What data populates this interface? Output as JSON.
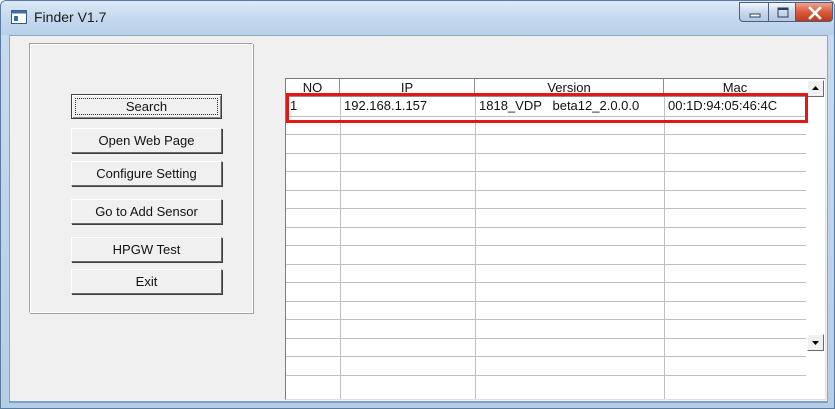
{
  "window": {
    "title": "Finder V1.7",
    "icons": {
      "app": "window-app-icon",
      "minimize": "minimize-icon",
      "maximize": "maximize-icon",
      "close": "close-icon"
    }
  },
  "buttons": {
    "search": "Search",
    "open_web_page": "Open Web Page",
    "configure_setting": "Configure Setting",
    "add_sensor": "Go to Add Sensor",
    "hpgw_test": "HPGW Test",
    "exit": "Exit"
  },
  "device_list": {
    "columns": [
      "NO",
      "IP",
      "Version",
      "Mac"
    ],
    "rows": [
      {
        "no": "1",
        "ip": "192.168.1.157",
        "version": "1818_VDP   beta12_2.0.0.0",
        "mac": "00:1D:94:05:46:4C"
      }
    ],
    "scroll_icons": {
      "up": "scroll-up-arrow-icon",
      "down": "scroll-down-arrow-icon"
    }
  },
  "colors": {
    "highlight": "#e01818",
    "close_button": "#c2371b",
    "titlebar": "#c5d9ef"
  }
}
